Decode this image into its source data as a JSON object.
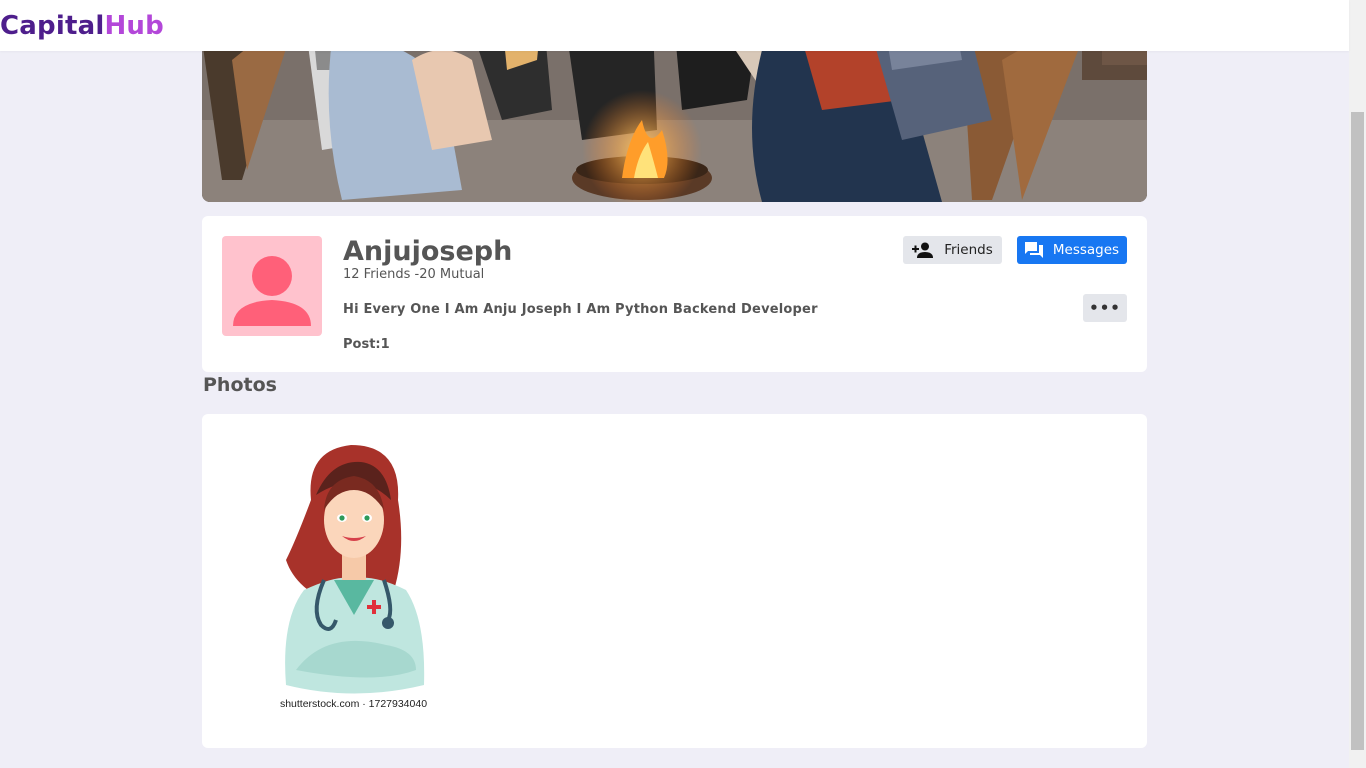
{
  "app": {
    "brand_part1": "Capital",
    "brand_part2": "Hub"
  },
  "profile": {
    "username": "Anjujoseph",
    "friends_summary": "12 Friends -20 Mutual",
    "bio": "Hi Every One I Am Anju Joseph I Am Python Backend Developer",
    "posts": "Post:1",
    "avatar_icon": "user-silhouette-icon"
  },
  "actions": {
    "friends_label": "Friends",
    "friends_icon": "person-add-icon",
    "messages_label": "Messages",
    "messages_icon": "chat-bubbles-icon",
    "more_label": "•••"
  },
  "photos": {
    "title": "Photos",
    "items": [
      {
        "caption": "shutterstock.com · 1727934040"
      }
    ]
  },
  "colors": {
    "brand_dark": "#4e1e8c",
    "brand_light": "#b347d9",
    "primary_button": "#1877f2",
    "secondary_button": "#e4e6eb",
    "page_background": "#efeef7",
    "avatar_background": "#ffc2cd",
    "avatar_figure": "#ff6079"
  }
}
